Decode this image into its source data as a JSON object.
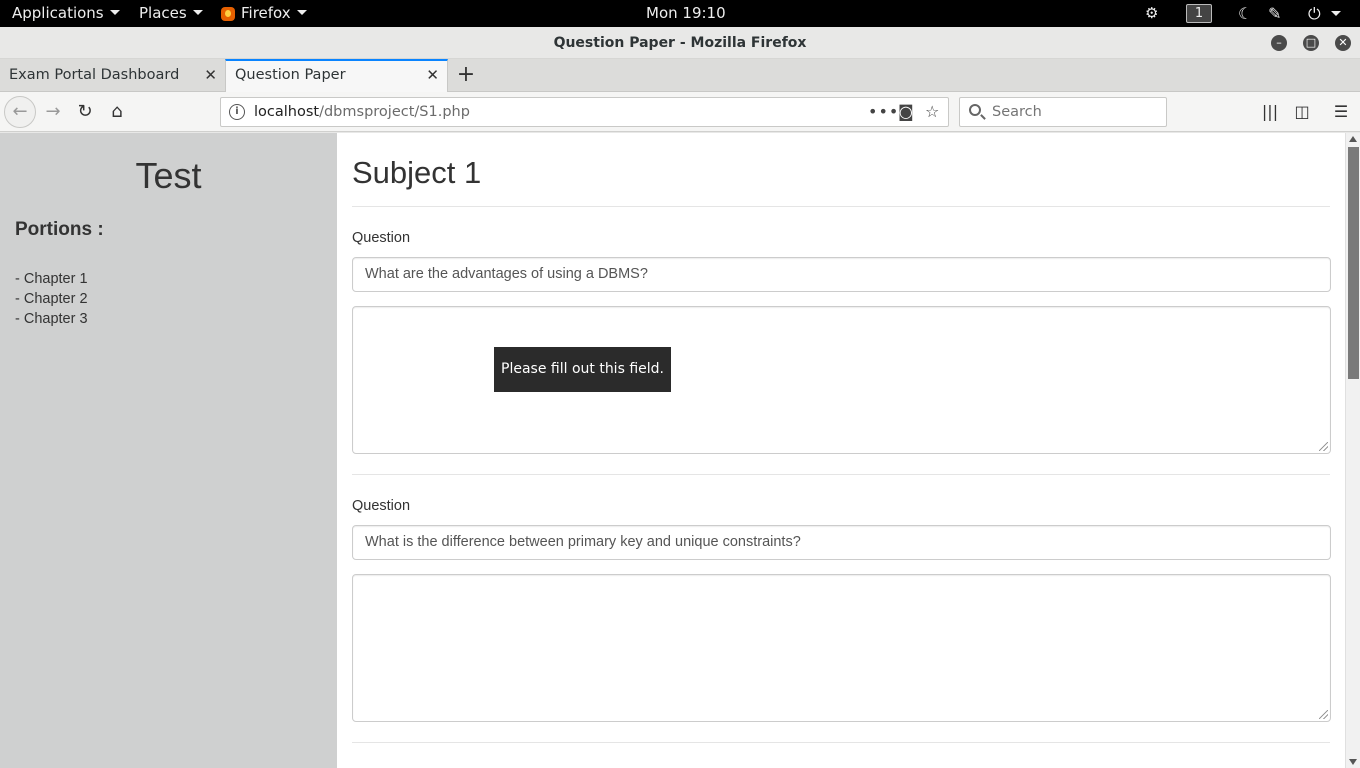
{
  "topbar": {
    "applications": "Applications",
    "places": "Places",
    "firefox": "Firefox",
    "clock": "Mon 19:10",
    "workspace": "1"
  },
  "window": {
    "title": "Question Paper - Mozilla Firefox"
  },
  "tabs": [
    {
      "label": "Exam Portal Dashboard",
      "active": false
    },
    {
      "label": "Question Paper",
      "active": true
    }
  ],
  "navbar": {
    "url_host": "localhost",
    "url_path": "/dbmsproject/S1.php",
    "search_placeholder": "Search"
  },
  "sidebar": {
    "title": "Test",
    "portions_label": "Portions :",
    "chapters": [
      "- Chapter 1",
      "- Chapter 2",
      "- Chapter 3"
    ]
  },
  "main": {
    "subject": "Subject 1",
    "questions": [
      {
        "label": "Question",
        "text": "What are the advantages of using a DBMS?",
        "answer": ""
      },
      {
        "label": "Question",
        "text": "What is the difference between primary key and unique constraints?",
        "answer": ""
      }
    ],
    "validation_tooltip": "Please fill out this field."
  },
  "colors": {
    "accent_tab": "#0a84ff",
    "sidebar_bg": "#cfd0d0",
    "tooltip_bg": "#2b2b2b"
  }
}
